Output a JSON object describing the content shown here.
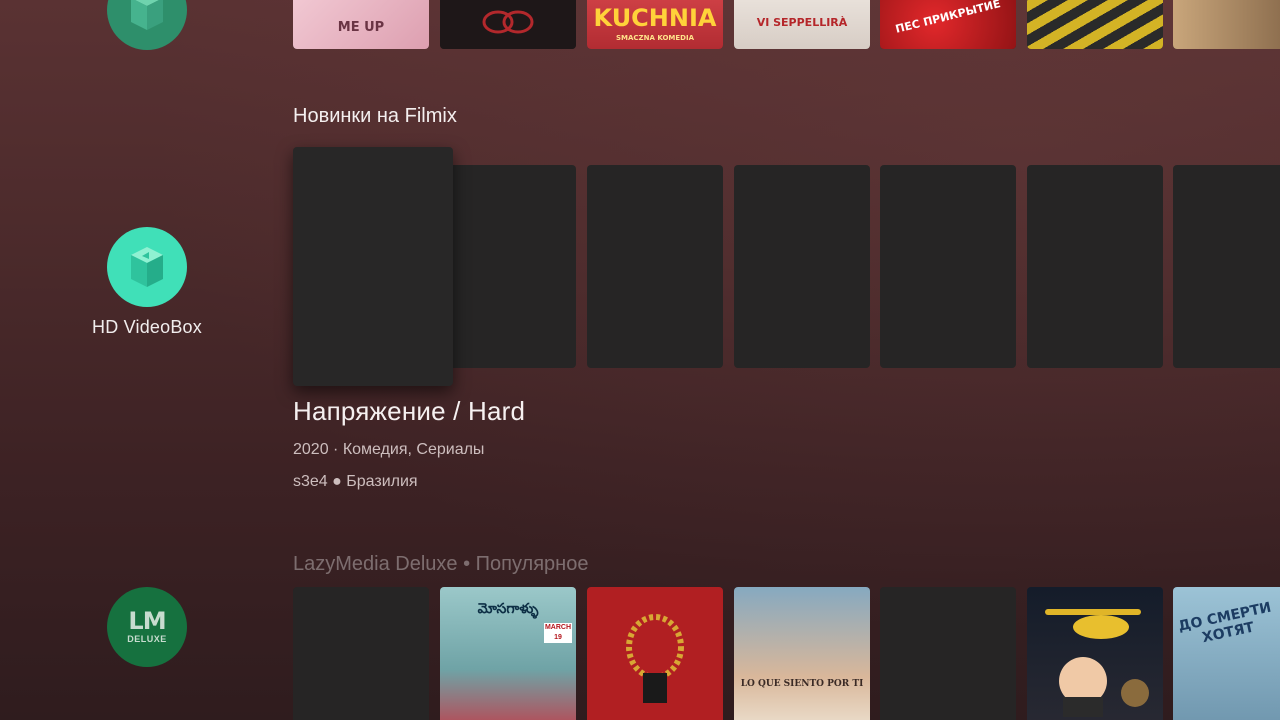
{
  "apps": {
    "top": {
      "icon": "videobox-cube-icon"
    },
    "hd_videobox": {
      "label": "HD VideoBox",
      "icon": "videobox-cube-icon",
      "color": "#40e0b8"
    },
    "lazymedia": {
      "logo_text": "LM",
      "logo_sub": "DELUXE",
      "icon": "lazymedia-logo-icon",
      "color": "#16713f"
    }
  },
  "row1": {
    "posters": [
      {
        "text": "ME UP",
        "color": "#e9b8c4"
      },
      {
        "text": "",
        "color": "#2a1a1c"
      },
      {
        "text": "KUCHNIA",
        "sub": "SMACZNA KOMEDIA",
        "color": "#c7363c"
      },
      {
        "text": "VI SEPPELLIRÀ",
        "color": "#e4dcd6"
      },
      {
        "text": "ПЕС ПРИКРЫТИЕ",
        "color": "#c81f22"
      },
      {
        "text": "",
        "color": "#6b6457"
      },
      {
        "text": "",
        "color": "#a88d6c"
      }
    ]
  },
  "row2": {
    "title": "Новинки на Filmix",
    "card_count": 7
  },
  "details": {
    "title": "Напряжение / Hard",
    "meta": "2020 · Комедия, Сериалы",
    "meta2": "s3e4 ● Бразилия"
  },
  "row3": {
    "title": "LazyMedia Deluxe • Популярное",
    "posters": [
      {
        "text": "",
        "color": "#262525"
      },
      {
        "text": "మోసగాళ్ళు",
        "sub": "MARCH 19",
        "color": "#7fb3b5"
      },
      {
        "text": "",
        "color": "#b11f22"
      },
      {
        "text": "LO QUE SIENTO POR TI",
        "color": "#d9c7a8"
      },
      {
        "text": "",
        "color": "#262525"
      },
      {
        "text": "",
        "color": "#1f2a3a"
      },
      {
        "text": "ДО СМЕРТИ ХОТЯТ",
        "color": "#7fa3b7"
      }
    ]
  }
}
